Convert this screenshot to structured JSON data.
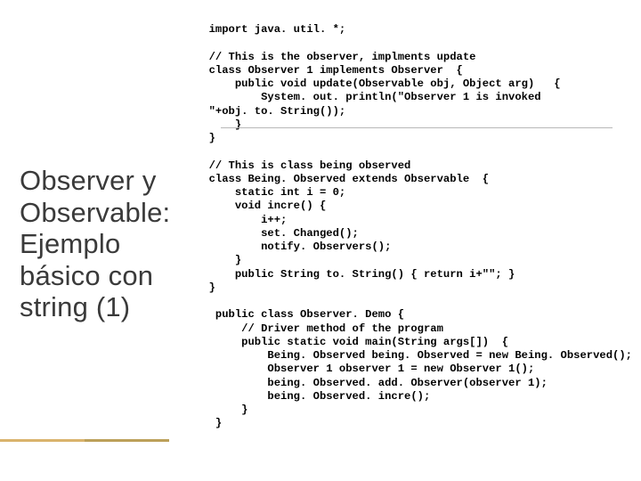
{
  "slide": {
    "title": "Observer y Observable: Ejemplo básico con string (1)",
    "code": "import java. util. *;\n\n// This is the observer, implments update\nclass Observer 1 implements Observer  {\n    public void update(Observable obj, Object arg)   {\n        System. out. println(\"Observer 1 is invoked\n\"+obj. to. String());\n    }\n}\n\n// This is class being observed\nclass Being. Observed extends Observable  {\n    static int i = 0;\n    void incre() {\n        i++;\n        set. Changed();\n        notify. Observers();\n    }\n    public String to. String() { return i+\"\"; }\n}\n\n public class Observer. Demo {\n     // Driver method of the program\n     public static void main(String args[])  {\n         Being. Observed being. Observed = new Being. Observed();\n         Observer 1 observer 1 = new Observer 1();\n         being. Observed. add. Observer(observer 1);\n         being. Observed. incre();\n     }\n }"
  }
}
